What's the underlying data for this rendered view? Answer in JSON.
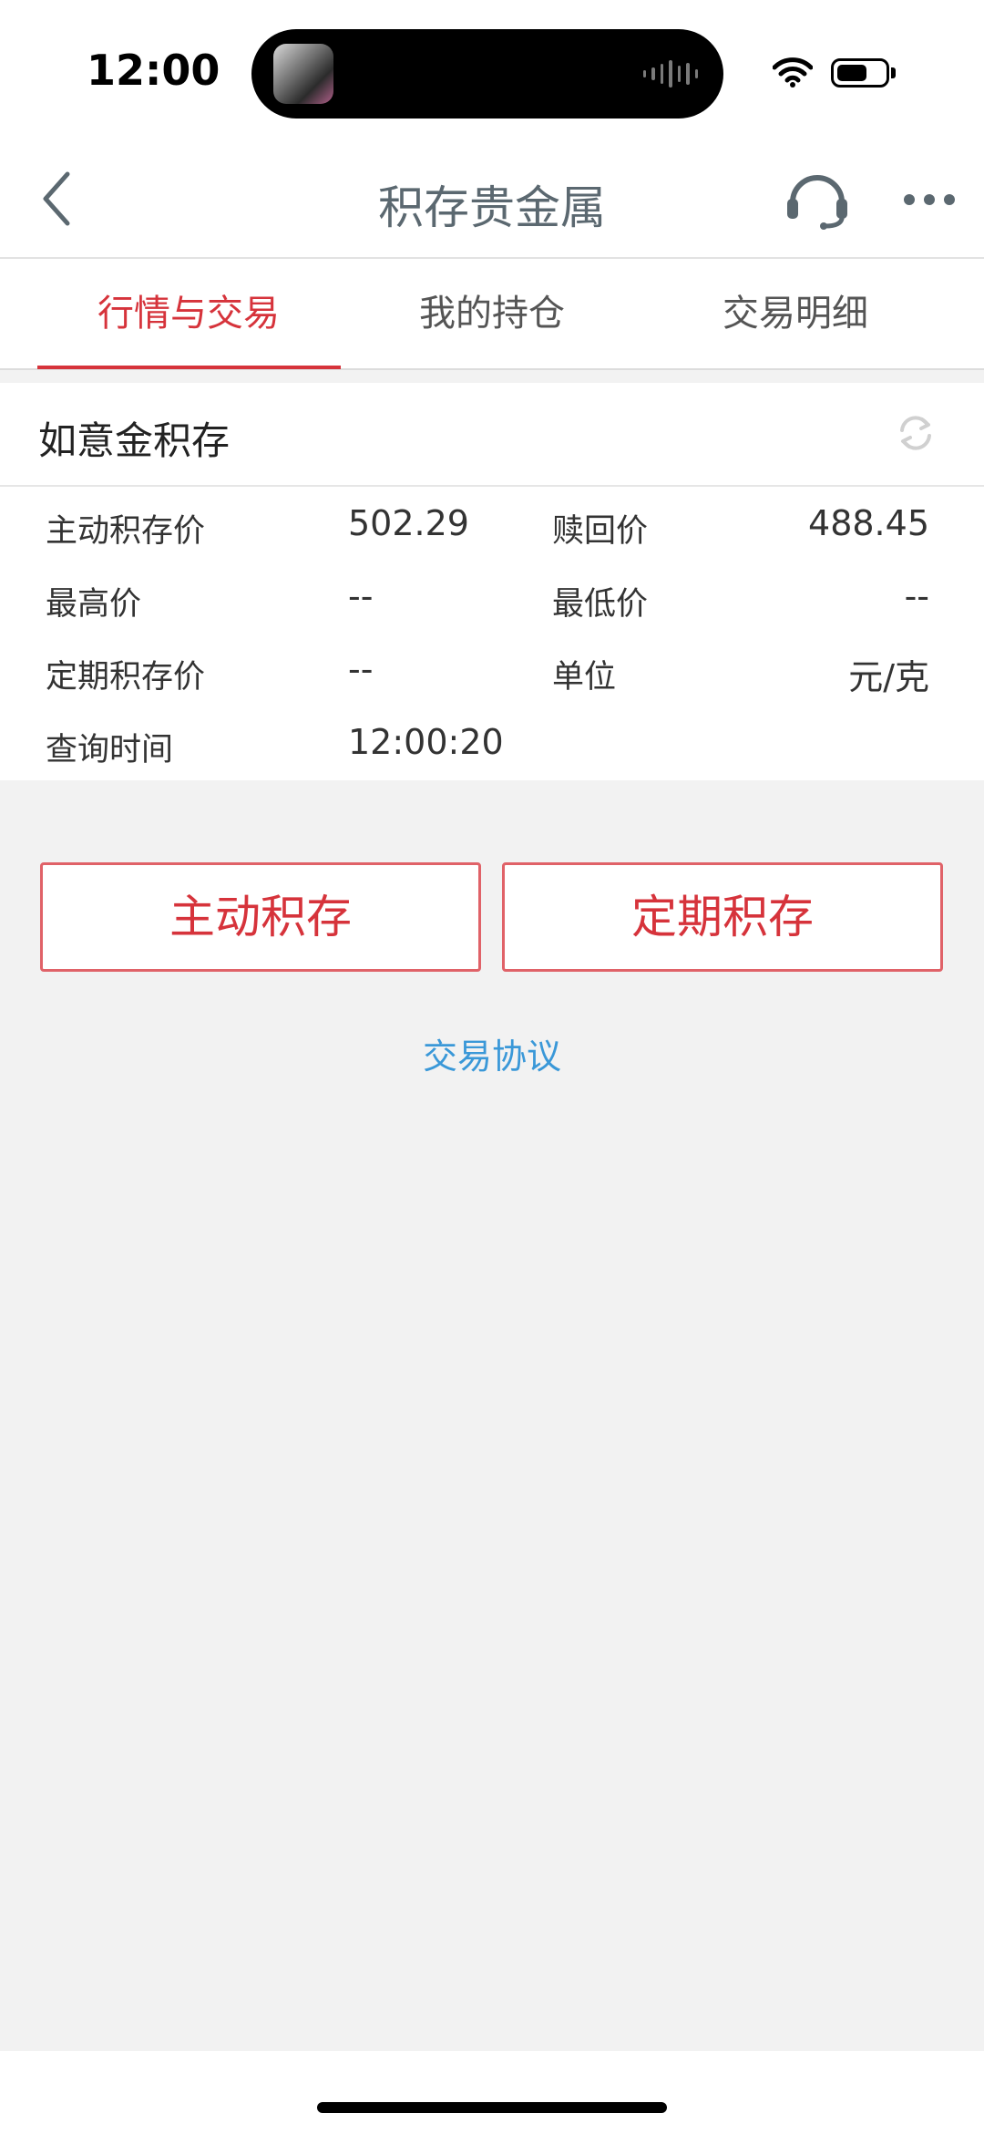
{
  "status": {
    "time": "12:00"
  },
  "nav": {
    "title": "积存贵金属",
    "back_icon": "chevron-left-icon",
    "service_icon": "headset-icon",
    "more_icon": "more-dots-icon"
  },
  "tabs": [
    {
      "label": "行情与交易",
      "active": true
    },
    {
      "label": "我的持仓",
      "active": false
    },
    {
      "label": "交易明细",
      "active": false
    }
  ],
  "product": {
    "name": "如意金积存",
    "refresh_icon": "refresh-icon"
  },
  "prices": {
    "active_price": {
      "label": "主动积存价",
      "value": "502.29"
    },
    "redeem_price": {
      "label": "赎回价",
      "value": "488.45"
    },
    "high_price": {
      "label": "最高价",
      "value": "--"
    },
    "low_price": {
      "label": "最低价",
      "value": "--"
    },
    "fixed_price": {
      "label": "定期积存价",
      "value": "--"
    },
    "unit": {
      "label": "单位",
      "value": "元/克"
    },
    "query_time": {
      "label": "查询时间",
      "value": "12:00:20"
    }
  },
  "actions": {
    "active_save": "主动积存",
    "fixed_save": "定期积存"
  },
  "agreement": "交易协议",
  "colors": {
    "accent": "#d6333b",
    "link": "#3a98d8",
    "background": "#f2f2f2"
  }
}
